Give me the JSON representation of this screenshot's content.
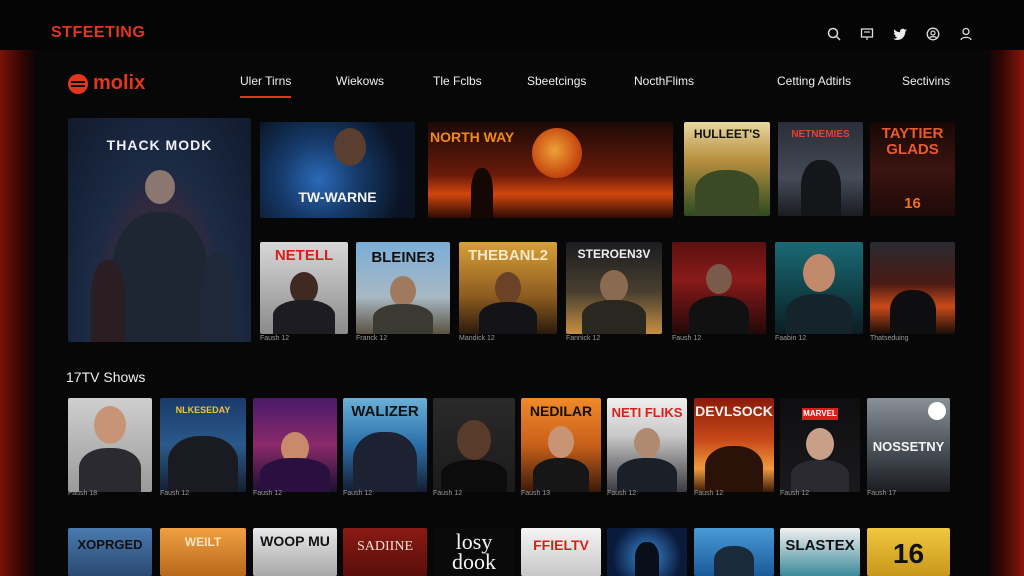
{
  "app": {
    "brand": "STFEETING",
    "logo_text": "molix"
  },
  "top_icons": [
    "search-icon",
    "cast-icon",
    "twitter-icon",
    "account-circle-icon",
    "user-icon"
  ],
  "nav": [
    {
      "label": "Uler Tirns",
      "active": true
    },
    {
      "label": "Wiekows"
    },
    {
      "label": "Tle Fclbs"
    },
    {
      "label": "Sbeetcings"
    },
    {
      "label": "NocthFlims"
    },
    {
      "label": "Cetting Adtirls"
    },
    {
      "label": "Sectivins"
    }
  ],
  "hero": {
    "title": "THACK MODK"
  },
  "featured": [
    {
      "title": "TW-WARNE"
    },
    {
      "title": "NORTH WAY"
    },
    {
      "title": "HULLEET'S"
    },
    {
      "title": "NETNEMIES"
    },
    {
      "title": "TAYTIER GLADS",
      "extra": "16"
    }
  ],
  "row1": [
    {
      "title": "NETELL",
      "caption": "Faush 12"
    },
    {
      "title": "BLEINE3",
      "caption": "Franck 12"
    },
    {
      "title": "THEBANL2",
      "caption": "Mandick 12"
    },
    {
      "title": "STEROEN3V",
      "caption": "Fannick 12"
    },
    {
      "title": "",
      "caption": "Faush 12"
    },
    {
      "title": "",
      "caption": "Faabin 12"
    },
    {
      "title": "",
      "caption": "Thatseduing"
    }
  ],
  "section": {
    "title": "17TV Shows"
  },
  "row2": [
    {
      "title": "",
      "caption": "Faush 18"
    },
    {
      "title": "NLKESEDAY",
      "caption": "Faush 12"
    },
    {
      "title": "",
      "caption": "Faush 12"
    },
    {
      "title": "WALIZER",
      "caption": "Faush 12"
    },
    {
      "title": "",
      "caption": "Faush 12"
    },
    {
      "title": "NEDILAR",
      "caption": "Faush 13"
    },
    {
      "title": "NETI FLIKS",
      "caption": "Faush 12"
    },
    {
      "title": "DEVLSOCK",
      "caption": "Faush 12"
    },
    {
      "title": "MARVEL",
      "caption": "Faush 12"
    },
    {
      "title": "NOSSETNY",
      "caption": "Faush 17"
    }
  ],
  "row3": [
    {
      "title": "XOPRGED"
    },
    {
      "title": "WEILT"
    },
    {
      "title": "WOOP MU"
    },
    {
      "title": "SADIINE"
    },
    {
      "title": "losy dook"
    },
    {
      "title": "FFIELTV"
    },
    {
      "title": ""
    },
    {
      "title": ""
    },
    {
      "title": "SLASTEX"
    },
    {
      "title": "16"
    }
  ],
  "colors": {
    "accent": "#e2371c",
    "background": "#050505"
  }
}
